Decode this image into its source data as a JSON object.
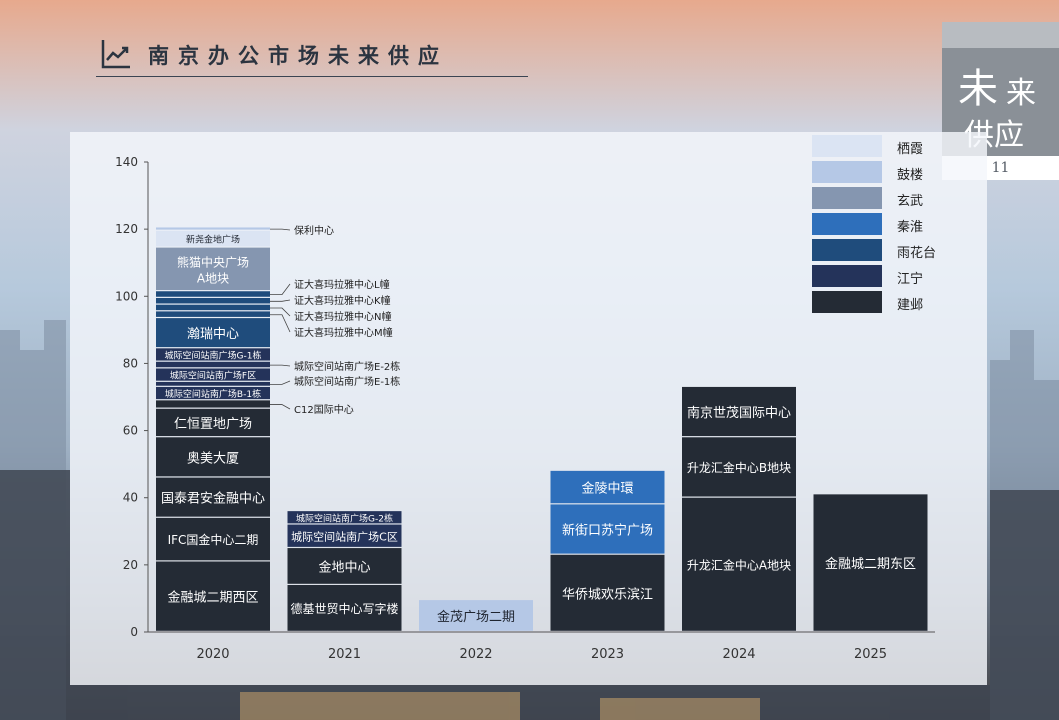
{
  "page": {
    "title": "南京办公市场未来供应",
    "side_tab": {
      "line1a": "未",
      "line1b": "来",
      "line2": "供应"
    },
    "page_number": "11"
  },
  "colors": {
    "栖霞": "#dbe4f3",
    "鼓楼": "#b5c8e6",
    "玄武": "#8596b0",
    "秦淮": "#2e6fbb",
    "雨花台": "#1f4c7c",
    "江宁": "#24335a",
    "建邺": "#242b35"
  },
  "chart_data": {
    "type": "bar",
    "stacked": true,
    "categories": [
      "2020",
      "2021",
      "2022",
      "2023",
      "2024",
      "2025"
    ],
    "ylim": [
      0,
      140
    ],
    "yticks": [
      0,
      20,
      40,
      60,
      80,
      100,
      120,
      140
    ],
    "legend": [
      "栖霞",
      "鼓楼",
      "玄武",
      "秦淮",
      "雨花台",
      "江宁",
      "建邺"
    ],
    "legend_position": "top-right",
    "grid": false,
    "stacks": [
      {
        "category": "2020",
        "segments": [
          {
            "name": "金融城二期西区",
            "value": 21,
            "district": "建邺",
            "label": "inside"
          },
          {
            "name": "IFC国金中心二期",
            "value": 13,
            "district": "建邺",
            "label": "inside"
          },
          {
            "name": "国泰君安金融中心",
            "value": 12,
            "district": "建邺",
            "label": "inside"
          },
          {
            "name": "奥美大厦",
            "value": 12,
            "district": "建邺",
            "label": "inside"
          },
          {
            "name": "仁恒置地广场",
            "value": 8.5,
            "district": "建邺",
            "label": "inside"
          },
          {
            "name": "C12国际中心",
            "value": 2.5,
            "district": "建邺",
            "label": "callout"
          },
          {
            "name": "城际空间站南广场B-1栋",
            "value": 4,
            "district": "江宁",
            "label": "inside"
          },
          {
            "name": "城际空间站南广场E-1栋",
            "value": 1.5,
            "district": "江宁",
            "label": "callout"
          },
          {
            "name": "城际空间站南广场F区",
            "value": 4,
            "district": "江宁",
            "label": "inside"
          },
          {
            "name": "城际空间站南广场E-2栋",
            "value": 2,
            "district": "江宁",
            "label": "callout"
          },
          {
            "name": "城际空间站南广场G-1栋",
            "value": 4,
            "district": "江宁",
            "label": "inside"
          },
          {
            "name": "瀚瑞中心",
            "value": 9,
            "district": "雨花台",
            "label": "inside"
          },
          {
            "name": "证大喜玛拉雅中心M幢",
            "value": 2,
            "district": "雨花台",
            "label": "callout"
          },
          {
            "name": "证大喜玛拉雅中心N幢",
            "value": 2,
            "district": "雨花台",
            "label": "callout"
          },
          {
            "name": "证大喜玛拉雅中心K幢",
            "value": 2,
            "district": "雨花台",
            "label": "callout"
          },
          {
            "name": "证大喜玛拉雅中心L幢",
            "value": 2,
            "district": "雨花台",
            "label": "callout"
          },
          {
            "name": "熊猫中央广场A地块",
            "value": 13,
            "district": "玄武",
            "label": "inside"
          },
          {
            "name": "新尧金地广场",
            "value": 5,
            "district": "栖霞",
            "label": "inside"
          },
          {
            "name": "保利中心",
            "value": 1,
            "district": "鼓楼",
            "label": "callout"
          }
        ]
      },
      {
        "category": "2021",
        "segments": [
          {
            "name": "德基世贸中心写字楼",
            "value": 14,
            "district": "建邺",
            "label": "inside"
          },
          {
            "name": "金地中心",
            "value": 11,
            "district": "建邺",
            "label": "inside"
          },
          {
            "name": "城际空间站南广场C区",
            "value": 7,
            "district": "江宁",
            "label": "inside"
          },
          {
            "name": "城际空间站南广场G-2栋",
            "value": 4,
            "district": "江宁",
            "label": "inside"
          }
        ]
      },
      {
        "category": "2022",
        "segments": [
          {
            "name": "金茂广场二期",
            "value": 9.5,
            "district": "鼓楼",
            "label": "inside"
          }
        ]
      },
      {
        "category": "2023",
        "segments": [
          {
            "name": "华侨城欢乐滨江",
            "value": 23,
            "district": "建邺",
            "label": "inside"
          },
          {
            "name": "新街口苏宁广场",
            "value": 15,
            "district": "秦淮",
            "label": "inside"
          },
          {
            "name": "金陵中環",
            "value": 10,
            "district": "秦淮",
            "label": "inside"
          }
        ]
      },
      {
        "category": "2024",
        "segments": [
          {
            "name": "升龙汇金中心A地块",
            "value": 40,
            "district": "建邺",
            "label": "inside"
          },
          {
            "name": "升龙汇金中心B地块",
            "value": 18,
            "district": "建邺",
            "label": "inside"
          },
          {
            "name": "南京世茂国际中心",
            "value": 15,
            "district": "建邺",
            "label": "inside"
          }
        ]
      },
      {
        "category": "2025",
        "segments": [
          {
            "name": "金融城二期东区",
            "value": 41,
            "district": "建邺",
            "label": "inside"
          }
        ]
      }
    ]
  }
}
